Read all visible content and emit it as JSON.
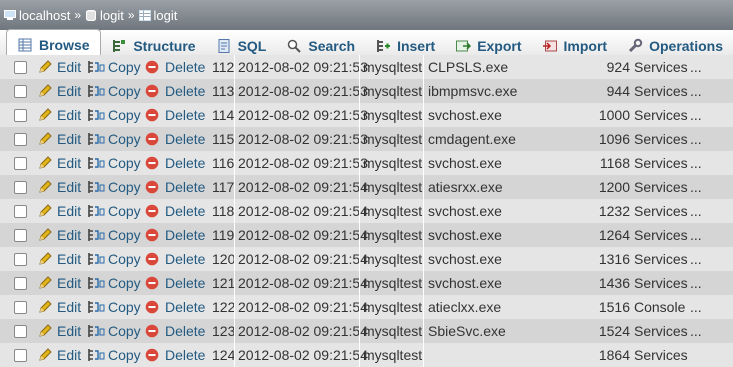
{
  "breadcrumb": {
    "server": "localhost",
    "database": "logit",
    "table": "logit",
    "separator": "»"
  },
  "tabs": [
    {
      "label": "Browse",
      "icon": "browse-icon",
      "active": true
    },
    {
      "label": "Structure",
      "icon": "structure-icon"
    },
    {
      "label": "SQL",
      "icon": "sql-icon"
    },
    {
      "label": "Search",
      "icon": "search-icon"
    },
    {
      "label": "Insert",
      "icon": "insert-icon"
    },
    {
      "label": "Export",
      "icon": "export-icon"
    },
    {
      "label": "Import",
      "icon": "import-icon"
    },
    {
      "label": "Operations",
      "icon": "wrench-icon"
    }
  ],
  "actions": {
    "edit": "Edit",
    "copy": "Copy",
    "delete": "Delete"
  },
  "rows": [
    {
      "id": "112",
      "ts": "2012-08-02 09:21:53",
      "user": "mysqltest",
      "exe": "CLPSLS.exe",
      "pid": "924",
      "kind": "Services",
      "more": "..."
    },
    {
      "id": "113",
      "ts": "2012-08-02 09:21:53",
      "user": "mysqltest",
      "exe": "ibmpmsvc.exe",
      "pid": "944",
      "kind": "Services",
      "more": "..."
    },
    {
      "id": "114",
      "ts": "2012-08-02 09:21:53",
      "user": "mysqltest",
      "exe": "svchost.exe",
      "pid": "1000",
      "kind": "Services",
      "more": "..."
    },
    {
      "id": "115",
      "ts": "2012-08-02 09:21:53",
      "user": "mysqltest",
      "exe": "cmdagent.exe",
      "pid": "1096",
      "kind": "Services",
      "more": "..."
    },
    {
      "id": "116",
      "ts": "2012-08-02 09:21:53",
      "user": "mysqltest",
      "exe": "svchost.exe",
      "pid": "1168",
      "kind": "Services",
      "more": "..."
    },
    {
      "id": "117",
      "ts": "2012-08-02 09:21:54",
      "user": "mysqltest",
      "exe": "atiesrxx.exe",
      "pid": "1200",
      "kind": "Services",
      "more": "..."
    },
    {
      "id": "118",
      "ts": "2012-08-02 09:21:54",
      "user": "mysqltest",
      "exe": "svchost.exe",
      "pid": "1232",
      "kind": "Services",
      "more": "..."
    },
    {
      "id": "119",
      "ts": "2012-08-02 09:21:54",
      "user": "mysqltest",
      "exe": "svchost.exe",
      "pid": "1264",
      "kind": "Services",
      "more": "..."
    },
    {
      "id": "120",
      "ts": "2012-08-02 09:21:54",
      "user": "mysqltest",
      "exe": "svchost.exe",
      "pid": "1316",
      "kind": "Services",
      "more": "..."
    },
    {
      "id": "121",
      "ts": "2012-08-02 09:21:54",
      "user": "mysqltest",
      "exe": "svchost.exe",
      "pid": "1436",
      "kind": "Services",
      "more": "..."
    },
    {
      "id": "122",
      "ts": "2012-08-02 09:21:54",
      "user": "mysqltest",
      "exe": "atieclxx.exe",
      "pid": "1516",
      "kind": "Console",
      "more": "..."
    },
    {
      "id": "123",
      "ts": "2012-08-02 09:21:54",
      "user": "mysqltest",
      "exe": "SbieSvc.exe",
      "pid": "1524",
      "kind": "Services",
      "more": "..."
    },
    {
      "id": "124",
      "ts": "2012-08-02 09:21:54",
      "user": "mysqltest",
      "exe": "",
      "pid": "1864",
      "kind": "Services",
      "more": ""
    }
  ],
  "colors": {
    "link": "#235a81",
    "row_odd": "#e5e5e5",
    "row_even": "#d5d5d5",
    "delete": "#d9483b",
    "pencil": "#e3b31c"
  }
}
